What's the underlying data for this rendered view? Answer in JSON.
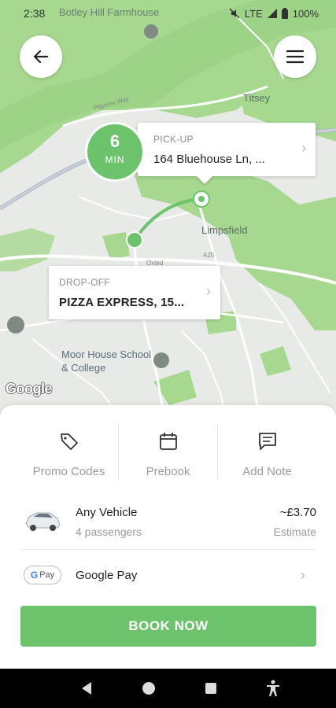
{
  "status_bar": {
    "time": "2:38",
    "network": "LTE",
    "battery": "100%"
  },
  "map": {
    "labels": {
      "farmhouse": "Botley Hill Farmhouse",
      "titsey": "Titsey",
      "limpsfield": "Limpsfield",
      "oxted": "Oxted",
      "school": "Moor House School & College",
      "road_pilgrims": "Pilgrims Way",
      "road_a25": "A25"
    },
    "attribution": "Google",
    "route_color": "#6cc36b"
  },
  "pickup": {
    "eta_value": "6",
    "eta_unit": "MIN",
    "tag": "PICK-UP",
    "address": "164 Bluehouse Ln, ..."
  },
  "dropoff": {
    "tag": "DROP-OFF",
    "address": "PIZZA EXPRESS, 15..."
  },
  "actions": [
    {
      "label": "Promo Codes",
      "icon": "tag-icon"
    },
    {
      "label": "Prebook",
      "icon": "calendar-icon"
    },
    {
      "label": "Add Note",
      "icon": "note-icon"
    }
  ],
  "vehicle": {
    "name": "Any Vehicle",
    "passengers": "4 passengers",
    "price": "~£3.70",
    "price_note": "Estimate"
  },
  "payment": {
    "badge_g": "G",
    "badge_text": "Pay",
    "name": "Google Pay"
  },
  "book_button": "BOOK NOW",
  "colors": {
    "accent": "#6cc36b",
    "map_green": "#a6d890",
    "map_bg": "#e8eae7"
  }
}
